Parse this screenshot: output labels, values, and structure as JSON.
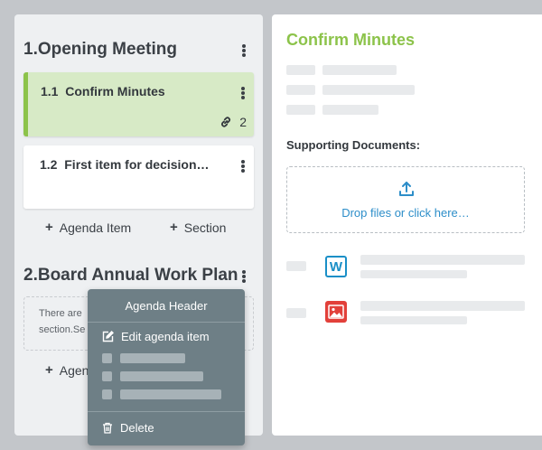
{
  "agenda": {
    "sections": [
      {
        "title": "1.Opening Meeting",
        "items": [
          {
            "number": "1.1",
            "title": "Confirm Minutes",
            "link_count": "2",
            "active": true
          },
          {
            "number": "1.2",
            "title": "First item for decision…",
            "active": false
          }
        ],
        "add_item_label": "Agenda Item",
        "add_section_label": "Section"
      },
      {
        "title": "2.Board Annual Work Plan",
        "empty_text_line1": "There are",
        "empty_text_line2": "section.Se",
        "add_item_label_partial": "Agen"
      }
    ]
  },
  "context_menu": {
    "header": "Agenda Header",
    "edit_label": "Edit agenda item",
    "delete_label": "Delete"
  },
  "detail": {
    "title": "Confirm Minutes",
    "supporting_documents_label": "Supporting Documents:",
    "dropzone_text": "Drop files or click here…",
    "documents": [
      {
        "icon": "word-document-icon",
        "color": "#1a8fc7"
      },
      {
        "icon": "image-file-icon",
        "color": "#e2403a"
      }
    ]
  },
  "colors": {
    "accent_green": "#8cc34a",
    "active_card_bg": "#d7eac6",
    "link_blue": "#2d8ec9",
    "menu_bg": "#6e7f86"
  }
}
